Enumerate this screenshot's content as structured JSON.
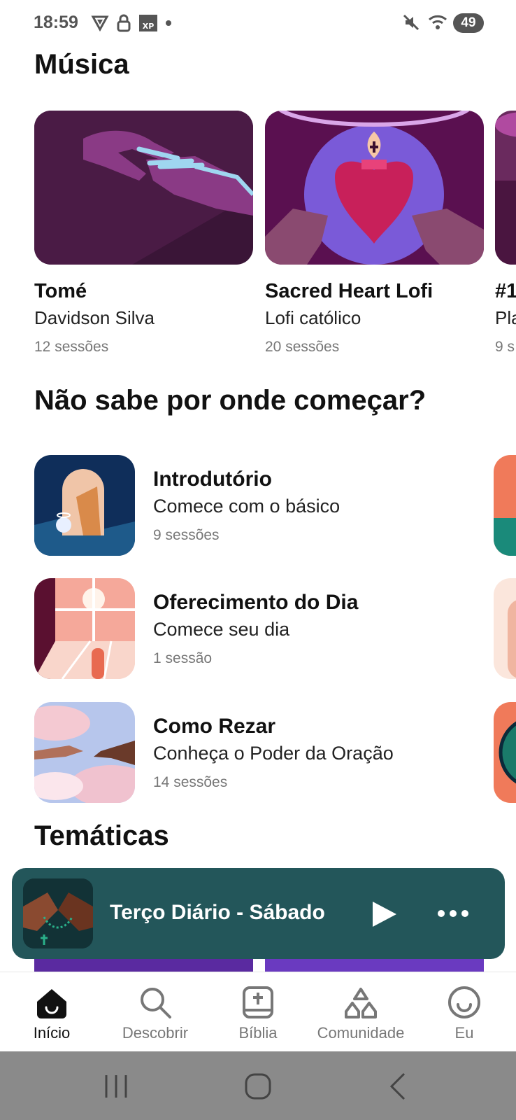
{
  "status_bar": {
    "time": "18:59",
    "battery": "49"
  },
  "sections": {
    "music_title": "Música",
    "start_title": "Não sabe por onde começar?",
    "themes_title": "Temáticas"
  },
  "music": [
    {
      "title": "Tomé",
      "subtitle": "Davidson Silva",
      "sessions": "12 sessões"
    },
    {
      "title": "Sacred Heart Lofi",
      "subtitle": "Lofi católico",
      "sessions": "20 sessões"
    },
    {
      "title": "#1",
      "subtitle": "Pla",
      "sessions": "9 s"
    }
  ],
  "starter": [
    {
      "title": "Introdutório",
      "subtitle": "Comece com o básico",
      "sessions": "9 sessões"
    },
    {
      "title": "Oferecimento do Dia",
      "subtitle": "Comece seu dia",
      "sessions": "1 sessão"
    },
    {
      "title": "Como Rezar",
      "subtitle": "Conheça o Poder da Oração",
      "sessions": "14 sessões"
    }
  ],
  "player": {
    "title": "Terço Diário - Sábado"
  },
  "nav": {
    "items": [
      {
        "label": "Início",
        "icon": "home-icon",
        "active": true
      },
      {
        "label": "Descobrir",
        "icon": "search-icon",
        "active": false
      },
      {
        "label": "Bíblia",
        "icon": "bible-icon",
        "active": false
      },
      {
        "label": "Comunidade",
        "icon": "community-icon",
        "active": false
      },
      {
        "label": "Eu",
        "icon": "profile-icon",
        "active": false
      }
    ]
  },
  "colors": {
    "player_bg": "#23565a",
    "purple": "#6b1f5c",
    "muted_text": "#777777"
  }
}
